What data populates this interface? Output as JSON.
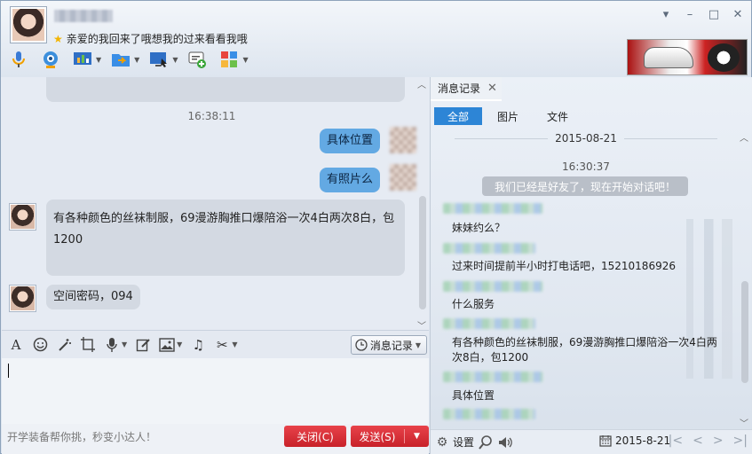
{
  "header": {
    "signature": "亲爱的我回来了哦想我的过来看看我哦",
    "window_controls": [
      "▾",
      "–",
      "□",
      "✕"
    ]
  },
  "toolbar_icons": [
    "microphone-icon",
    "webcam-icon",
    "screen-share-icon",
    "file-transfer-icon",
    "remote-desktop-icon",
    "invite-icon",
    "apps-icon"
  ],
  "chat": {
    "timestamp": "16:38:11",
    "messages": [
      {
        "direction": "out",
        "text": "具体位置"
      },
      {
        "direction": "out",
        "text": "有照片么"
      },
      {
        "direction": "in",
        "text": "有各种颜色的丝袜制服，69漫游胸推口爆陪浴一次4白两次8白，包1200"
      },
      {
        "direction": "in",
        "text": "空间密码，094"
      }
    ]
  },
  "input_toolbar": {
    "history_label": "消息记录"
  },
  "bottom": {
    "tip": "开学装备帮你挑，秒变小达人！",
    "close_label": "关闭(C)",
    "send_label": "发送(S)"
  },
  "history": {
    "tab_label": "消息记录",
    "filters": [
      "全部",
      "图片",
      "文件"
    ],
    "date": "2015-08-21",
    "time": "16:30:37",
    "system_message": "我们已经是好友了，现在开始对话吧！",
    "messages": [
      "妹妹约么？",
      "过来时间提前半小时打电话吧，15210186926",
      "什么服务",
      "有各种颜色的丝袜制服，69漫游胸推口爆陪浴一次4白两次8白，包1200",
      "具体位置"
    ],
    "settings_label": "设置",
    "bottom_date": "2015-8-21"
  }
}
